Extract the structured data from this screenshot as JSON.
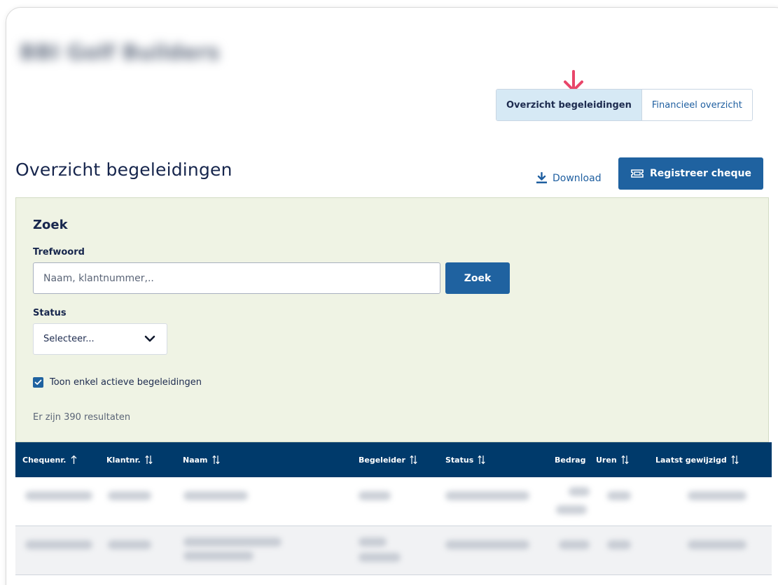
{
  "header": {
    "company_name": "BBI Golf Builders"
  },
  "tabs": [
    {
      "label": "Overzicht begeleidingen",
      "active": true
    },
    {
      "label": "Financieel overzicht",
      "active": false
    }
  ],
  "page": {
    "title": "Overzicht begeleidingen",
    "download_label": "Download",
    "register_label": "Registreer cheque"
  },
  "search": {
    "heading": "Zoek",
    "keyword_label": "Trefwoord",
    "keyword_placeholder": "Naam, klantnummer,..",
    "button_label": "Zoek",
    "status_label": "Status",
    "status_selected": "Selecteer...",
    "active_only_label": "Toon enkel actieve begeleidingen",
    "active_only_checked": true,
    "result_text": "Er zijn 390 resultaten"
  },
  "table": {
    "columns": [
      "Chequenr.",
      "Klantnr.",
      "Naam",
      "Begeleider",
      "Status",
      "Bedrag",
      "Uren",
      "Laatst gewijzigd"
    ]
  },
  "colors": {
    "primary": "#1f62a0",
    "table_header": "#003a6b",
    "panel_bg": "#eff3e4",
    "active_tab_bg": "#d6e9f5",
    "marker_arrow": "#e8466a"
  },
  "icons": {
    "marker": "arrow-down-icon",
    "download": "download-icon",
    "register": "ticket-icon",
    "select": "chevron-down-icon",
    "checkbox": "checkmark-icon",
    "sort_asc": "sort-ascending-icon",
    "sort_both": "sort-both-icon"
  }
}
